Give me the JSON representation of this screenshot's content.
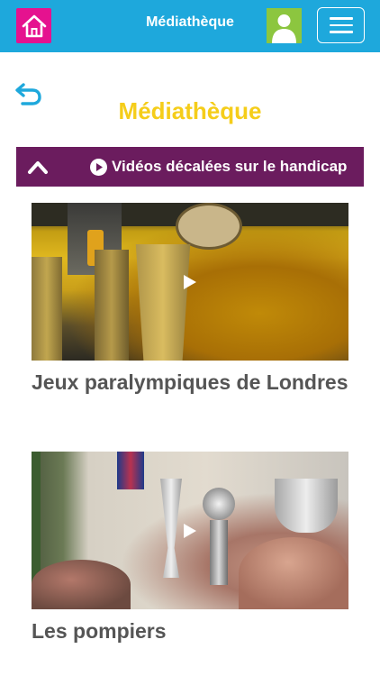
{
  "header": {
    "app_title": "Médiathèque",
    "home_icon": "home-icon",
    "account_icon": "user-icon",
    "menu_icon": "hamburger-menu-icon",
    "colors": {
      "bar": "#1ea8dc",
      "home": "#e5128f",
      "account": "#8cc63f"
    }
  },
  "page": {
    "back_icon": "back-arrow-icon",
    "title": "Médiathèque",
    "title_color": "#f5cd1a"
  },
  "section": {
    "title": "Vidéos décalées sur le handicap",
    "collapse_icon": "chevron-up-icon",
    "play_icon": "play-circle-icon",
    "color": "#6b1c5e"
  },
  "videos": [
    {
      "title": "Jeux paralympiques de Londres",
      "play_icon": "play-icon"
    },
    {
      "title": "Les pompiers",
      "play_icon": "play-icon"
    }
  ]
}
